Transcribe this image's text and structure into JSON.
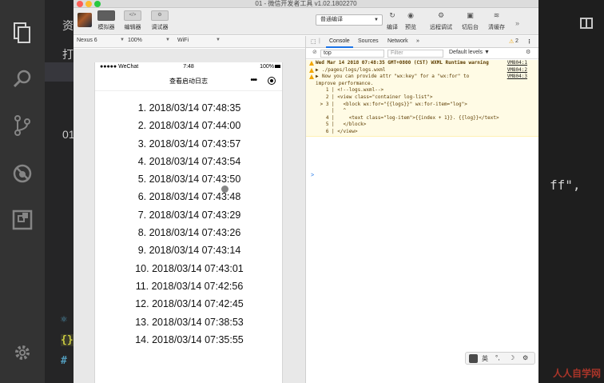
{
  "window": {
    "title": "01 - 微信开发者工具 v1.02.1802270"
  },
  "toolbar": {
    "simulator": "模拟器",
    "editor": "编辑器",
    "debugger": "调试器",
    "compile_mode": "普通编译",
    "compile": "编译",
    "preview": "预览",
    "remote_debug": "远程调试",
    "background": "切后台",
    "clear_cache": "清缓存"
  },
  "simbar": {
    "device": "Nexus 6",
    "zoom": "100%",
    "network": "WiFi"
  },
  "phone": {
    "carrier": "●●●●● WeChat",
    "time": "7:48",
    "battery": "100%",
    "nav_title": "查看启动日志",
    "logs": [
      "1. 2018/03/14 07:48:35",
      "2. 2018/03/14 07:44:00",
      "3. 2018/03/14 07:43:57",
      "4. 2018/03/14 07:43:54",
      "5. 2018/03/14 07:43:50",
      "6. 2018/03/14 07:43:48",
      "7. 2018/03/14 07:43:29",
      "8. 2018/03/14 07:43:26",
      "9. 2018/03/14 07:43:14",
      "10. 2018/03/14 07:43:01",
      "11. 2018/03/14 07:42:56",
      "12. 2018/03/14 07:42:45",
      "13. 2018/03/14 07:38:53",
      "14. 2018/03/14 07:35:55"
    ]
  },
  "devtools": {
    "tabs": [
      "Console",
      "Sources",
      "Network",
      "»"
    ],
    "warn_count": "2",
    "context": "top",
    "filter_placeholder": "Filter",
    "levels": "Default levels ▼",
    "warning_header": "Wed Mar 14 2018 07:48:35 GMT+0800 (CST) WXML Runtime warning",
    "warning_header_src": "VM804:1",
    "warning_path": "./pages/logs/logs.wxml",
    "warning_path_src": "VM804:2",
    "warning_msg1": "Now you can provide attr \"wx:key\" for a \"wx:for\" to",
    "warning_msg1_src": "VM804:3",
    "warning_msg2": "improve performance.",
    "code_lines": [
      "   1 | <!--logs.wxml-->",
      "   2 | <view class=\"container log-list\">",
      " > 3 |   <block wx:for=\"{{logs}}\" wx:for-item=\"log\">",
      "     |   ^",
      "   4 |     <text class=\"log-item\">{{index + 1}}. {{log}}</text>",
      "   5 |   </block>",
      "   6 | </view>"
    ],
    "prompt": ">"
  },
  "ime": {
    "lang": "英"
  },
  "vscode": {
    "side_text_1": "资",
    "side_text_2": "打",
    "side_text_3": "01",
    "code_fragment": "ff\",",
    "file_icon_1": "{}",
    "file_icon_2": "#"
  },
  "watermark": "人人自学网",
  "colors": {
    "accent": "#1a73e8",
    "warning_bg": "#fffbe5",
    "warning_icon": "#f2a600"
  }
}
